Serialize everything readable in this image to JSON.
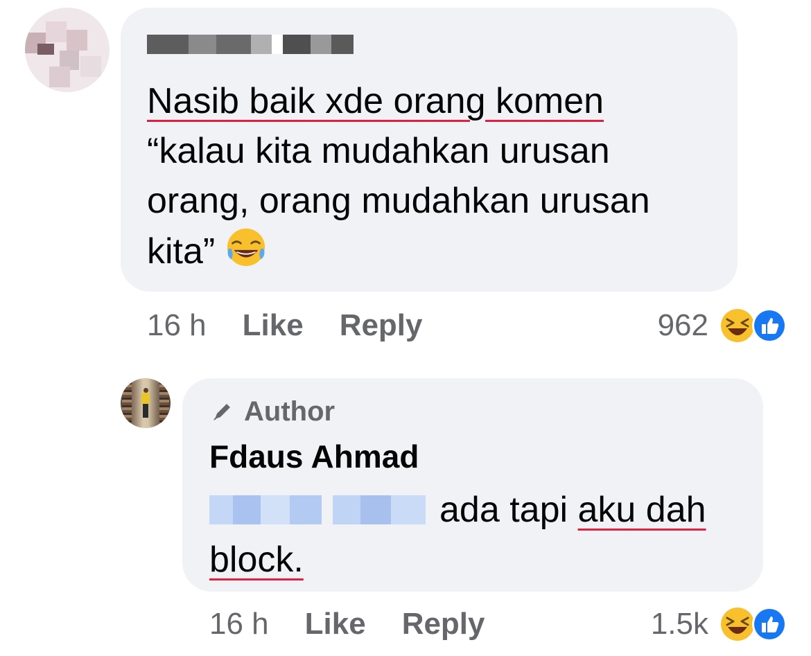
{
  "comments": [
    {
      "author_name_redacted": true,
      "text_lines": [
        "Nasib baik xde orang komen",
        "“kalau kita mudahkan urusan",
        "orang, orang mudahkan urusan",
        "kita”"
      ],
      "emoji": "laughing-tears-emoji",
      "time": "16 h",
      "like_label": "Like",
      "reply_label": "Reply",
      "reaction_count": "962",
      "reactions": [
        "haha-icon",
        "like-icon"
      ]
    },
    {
      "badge": "Author",
      "author_name": "Fdaus Ahmad",
      "mention_redacted": true,
      "text_main": "ada tapi",
      "text_underlined_1": "aku dah",
      "text_underlined_2": "block.",
      "time": "16 h",
      "like_label": "Like",
      "reply_label": "Reply",
      "reaction_count": "1.5k",
      "reactions": [
        "haha-icon",
        "like-icon"
      ]
    }
  ],
  "colors": {
    "bubble": "#f0f2f5",
    "meta_text": "#65676b",
    "underline": "#e41e3f",
    "like_blue": "#1877f2",
    "mention_blur": "#bfd3f5"
  }
}
